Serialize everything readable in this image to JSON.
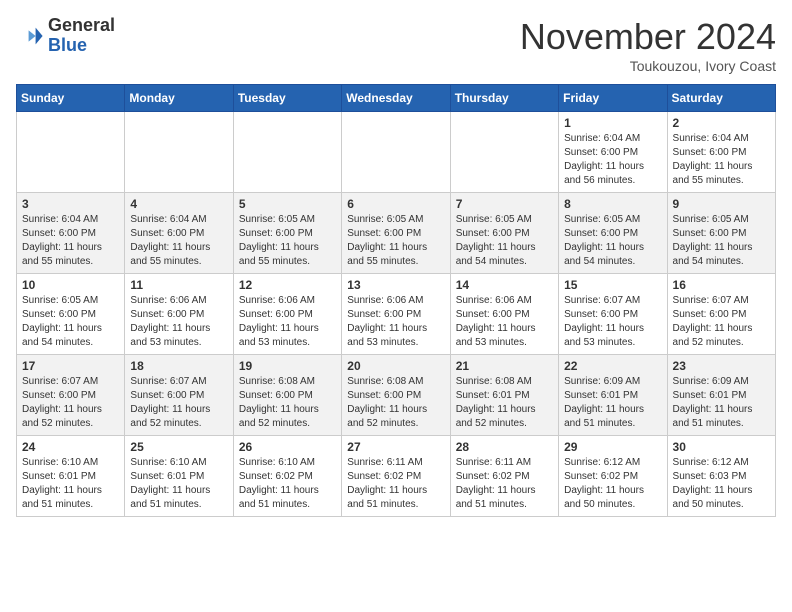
{
  "logo": {
    "general": "General",
    "blue": "Blue"
  },
  "header": {
    "month": "November 2024",
    "location": "Toukouzou, Ivory Coast"
  },
  "weekdays": [
    "Sunday",
    "Monday",
    "Tuesday",
    "Wednesday",
    "Thursday",
    "Friday",
    "Saturday"
  ],
  "weeks": [
    [
      {
        "day": "",
        "info": ""
      },
      {
        "day": "",
        "info": ""
      },
      {
        "day": "",
        "info": ""
      },
      {
        "day": "",
        "info": ""
      },
      {
        "day": "",
        "info": ""
      },
      {
        "day": "1",
        "info": "Sunrise: 6:04 AM\nSunset: 6:00 PM\nDaylight: 11 hours and 56 minutes."
      },
      {
        "day": "2",
        "info": "Sunrise: 6:04 AM\nSunset: 6:00 PM\nDaylight: 11 hours and 55 minutes."
      }
    ],
    [
      {
        "day": "3",
        "info": "Sunrise: 6:04 AM\nSunset: 6:00 PM\nDaylight: 11 hours and 55 minutes."
      },
      {
        "day": "4",
        "info": "Sunrise: 6:04 AM\nSunset: 6:00 PM\nDaylight: 11 hours and 55 minutes."
      },
      {
        "day": "5",
        "info": "Sunrise: 6:05 AM\nSunset: 6:00 PM\nDaylight: 11 hours and 55 minutes."
      },
      {
        "day": "6",
        "info": "Sunrise: 6:05 AM\nSunset: 6:00 PM\nDaylight: 11 hours and 55 minutes."
      },
      {
        "day": "7",
        "info": "Sunrise: 6:05 AM\nSunset: 6:00 PM\nDaylight: 11 hours and 54 minutes."
      },
      {
        "day": "8",
        "info": "Sunrise: 6:05 AM\nSunset: 6:00 PM\nDaylight: 11 hours and 54 minutes."
      },
      {
        "day": "9",
        "info": "Sunrise: 6:05 AM\nSunset: 6:00 PM\nDaylight: 11 hours and 54 minutes."
      }
    ],
    [
      {
        "day": "10",
        "info": "Sunrise: 6:05 AM\nSunset: 6:00 PM\nDaylight: 11 hours and 54 minutes."
      },
      {
        "day": "11",
        "info": "Sunrise: 6:06 AM\nSunset: 6:00 PM\nDaylight: 11 hours and 53 minutes."
      },
      {
        "day": "12",
        "info": "Sunrise: 6:06 AM\nSunset: 6:00 PM\nDaylight: 11 hours and 53 minutes."
      },
      {
        "day": "13",
        "info": "Sunrise: 6:06 AM\nSunset: 6:00 PM\nDaylight: 11 hours and 53 minutes."
      },
      {
        "day": "14",
        "info": "Sunrise: 6:06 AM\nSunset: 6:00 PM\nDaylight: 11 hours and 53 minutes."
      },
      {
        "day": "15",
        "info": "Sunrise: 6:07 AM\nSunset: 6:00 PM\nDaylight: 11 hours and 53 minutes."
      },
      {
        "day": "16",
        "info": "Sunrise: 6:07 AM\nSunset: 6:00 PM\nDaylight: 11 hours and 52 minutes."
      }
    ],
    [
      {
        "day": "17",
        "info": "Sunrise: 6:07 AM\nSunset: 6:00 PM\nDaylight: 11 hours and 52 minutes."
      },
      {
        "day": "18",
        "info": "Sunrise: 6:07 AM\nSunset: 6:00 PM\nDaylight: 11 hours and 52 minutes."
      },
      {
        "day": "19",
        "info": "Sunrise: 6:08 AM\nSunset: 6:00 PM\nDaylight: 11 hours and 52 minutes."
      },
      {
        "day": "20",
        "info": "Sunrise: 6:08 AM\nSunset: 6:00 PM\nDaylight: 11 hours and 52 minutes."
      },
      {
        "day": "21",
        "info": "Sunrise: 6:08 AM\nSunset: 6:01 PM\nDaylight: 11 hours and 52 minutes."
      },
      {
        "day": "22",
        "info": "Sunrise: 6:09 AM\nSunset: 6:01 PM\nDaylight: 11 hours and 51 minutes."
      },
      {
        "day": "23",
        "info": "Sunrise: 6:09 AM\nSunset: 6:01 PM\nDaylight: 11 hours and 51 minutes."
      }
    ],
    [
      {
        "day": "24",
        "info": "Sunrise: 6:10 AM\nSunset: 6:01 PM\nDaylight: 11 hours and 51 minutes."
      },
      {
        "day": "25",
        "info": "Sunrise: 6:10 AM\nSunset: 6:01 PM\nDaylight: 11 hours and 51 minutes."
      },
      {
        "day": "26",
        "info": "Sunrise: 6:10 AM\nSunset: 6:02 PM\nDaylight: 11 hours and 51 minutes."
      },
      {
        "day": "27",
        "info": "Sunrise: 6:11 AM\nSunset: 6:02 PM\nDaylight: 11 hours and 51 minutes."
      },
      {
        "day": "28",
        "info": "Sunrise: 6:11 AM\nSunset: 6:02 PM\nDaylight: 11 hours and 51 minutes."
      },
      {
        "day": "29",
        "info": "Sunrise: 6:12 AM\nSunset: 6:02 PM\nDaylight: 11 hours and 50 minutes."
      },
      {
        "day": "30",
        "info": "Sunrise: 6:12 AM\nSunset: 6:03 PM\nDaylight: 11 hours and 50 minutes."
      }
    ]
  ]
}
